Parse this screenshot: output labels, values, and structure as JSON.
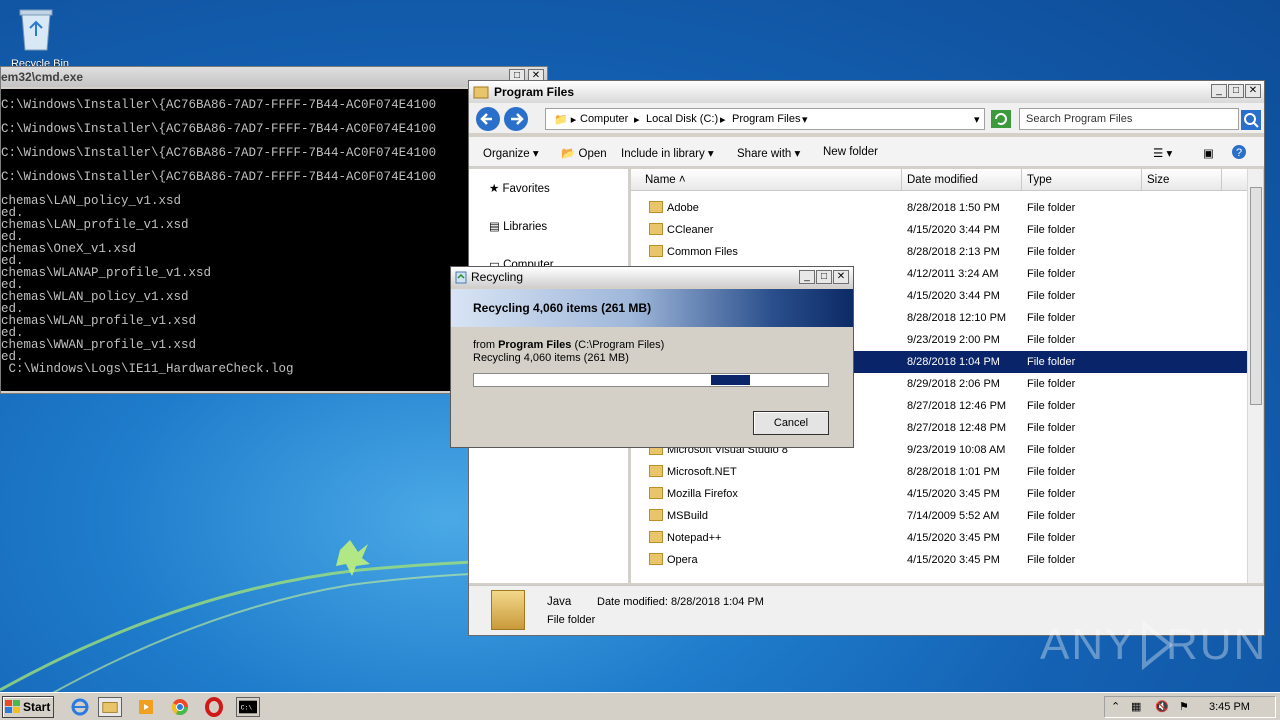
{
  "desktop": {
    "recycle_bin_label": "Recycle Bin"
  },
  "cmd": {
    "title": "em32\\cmd.exe",
    "lines": [
      "C:\\Windows\\Installer\\{AC76BA86-7AD7-FFFF-7B44-AC0F074E4100",
      "",
      "C:\\Windows\\Installer\\{AC76BA86-7AD7-FFFF-7B44-AC0F074E4100",
      "",
      "C:\\Windows\\Installer\\{AC76BA86-7AD7-FFFF-7B44-AC0F074E4100",
      "",
      "C:\\Windows\\Installer\\{AC76BA86-7AD7-FFFF-7B44-AC0F074E4100",
      "",
      "chemas\\LAN_policy_v1.xsd",
      "ed.",
      "chemas\\LAN_profile_v1.xsd",
      "ed.",
      "chemas\\OneX_v1.xsd",
      "ed.",
      "chemas\\WLANAP_profile_v1.xsd",
      "ed.",
      "chemas\\WLAN_policy_v1.xsd",
      "ed.",
      "chemas\\WLAN_profile_v1.xsd",
      "ed.",
      "chemas\\WWAN_profile_v1.xsd",
      "ed.",
      " C:\\Windows\\Logs\\IE11_HardwareCheck.log"
    ]
  },
  "explorer": {
    "title": "Program Files",
    "breadcrumb": [
      "Computer",
      "Local Disk (C:)",
      "Program Files"
    ],
    "search_placeholder": "Search Program Files",
    "toolbar": {
      "organize": "Organize",
      "open": "Open",
      "include": "Include in library",
      "share": "Share with",
      "new_folder": "New folder"
    },
    "nav": {
      "favorites": "Favorites",
      "libraries": "Libraries",
      "computer": "Computer"
    },
    "columns": {
      "name": "Name",
      "date": "Date modified",
      "type": "Type",
      "size": "Size"
    },
    "rows": [
      {
        "name": "Adobe",
        "date": "8/28/2018 1:50 PM",
        "type": "File folder"
      },
      {
        "name": "CCleaner",
        "date": "4/15/2020 3:44 PM",
        "type": "File folder"
      },
      {
        "name": "Common Files",
        "date": "8/28/2018 2:13 PM",
        "type": "File folder"
      },
      {
        "name": "",
        "date": "4/12/2011 3:24 AM",
        "type": "File folder"
      },
      {
        "name": "",
        "date": "4/15/2020 3:44 PM",
        "type": "File folder"
      },
      {
        "name": "",
        "date": "8/28/2018 12:10 PM",
        "type": "File folder"
      },
      {
        "name": "",
        "date": "9/23/2019 2:00 PM",
        "type": "File folder"
      },
      {
        "name": "",
        "date": "8/28/2018 1:04 PM",
        "type": "File folder"
      },
      {
        "name": "",
        "date": "8/29/2018 2:06 PM",
        "type": "File folder"
      },
      {
        "name": "",
        "date": "8/27/2018 12:46 PM",
        "type": "File folder"
      },
      {
        "name": "",
        "date": "8/27/2018 12:48 PM",
        "type": "File folder"
      },
      {
        "name": "Microsoft Visual Studio 8",
        "date": "9/23/2019 10:08 AM",
        "type": "File folder"
      },
      {
        "name": "Microsoft.NET",
        "date": "8/28/2018 1:01 PM",
        "type": "File folder"
      },
      {
        "name": "Mozilla Firefox",
        "date": "4/15/2020 3:45 PM",
        "type": "File folder"
      },
      {
        "name": "MSBuild",
        "date": "7/14/2009 5:52 AM",
        "type": "File folder"
      },
      {
        "name": "Notepad++",
        "date": "4/15/2020 3:45 PM",
        "type": "File folder"
      },
      {
        "name": "Opera",
        "date": "4/15/2020 3:45 PM",
        "type": "File folder"
      }
    ],
    "details": {
      "name": "Java",
      "date_label": "Date modified:",
      "date": "8/28/2018 1:04 PM",
      "type": "File folder"
    }
  },
  "dialog": {
    "title": "Recycling",
    "heading": "Recycling 4,060 items (261 MB)",
    "from_label": "from",
    "from_name": "Program Files",
    "from_path": "(C:\\Program Files)",
    "status": "Recycling 4,060 items (261 MB)",
    "progress_fraction": 0.78,
    "cancel": "Cancel"
  },
  "taskbar": {
    "start": "Start",
    "clock": "3:45 PM"
  },
  "watermark": "ANY RUN"
}
